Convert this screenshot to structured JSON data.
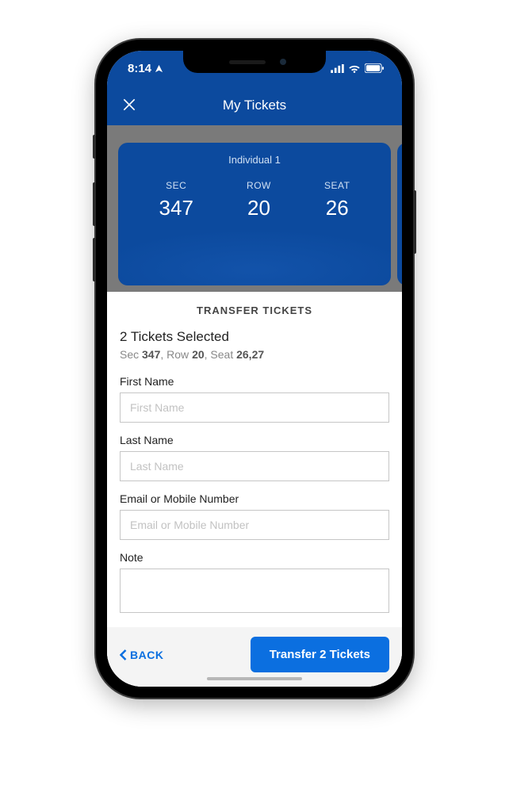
{
  "status": {
    "time": "8:14"
  },
  "nav": {
    "title": "My Tickets"
  },
  "ticket_card": {
    "label": "Individual 1",
    "sec_label": "SEC",
    "sec_value": "347",
    "row_label": "ROW",
    "row_value": "20",
    "seat_label": "SEAT",
    "seat_value": "26"
  },
  "form": {
    "header": "TRANSFER TICKETS",
    "selected_count": "2 Tickets Selected",
    "detail_sec_label": "Sec ",
    "detail_sec_value": "347",
    "detail_row_label": ", Row ",
    "detail_row_value": "20",
    "detail_seat_label": ", Seat ",
    "detail_seat_value": "26,27",
    "first_name_label": "First Name",
    "first_name_placeholder": "First Name",
    "last_name_label": "Last Name",
    "last_name_placeholder": "Last Name",
    "email_label": "Email or Mobile Number",
    "email_placeholder": "Email or Mobile Number",
    "note_label": "Note"
  },
  "footer": {
    "back_label": "BACK",
    "transfer_label": "Transfer 2 Tickets"
  }
}
